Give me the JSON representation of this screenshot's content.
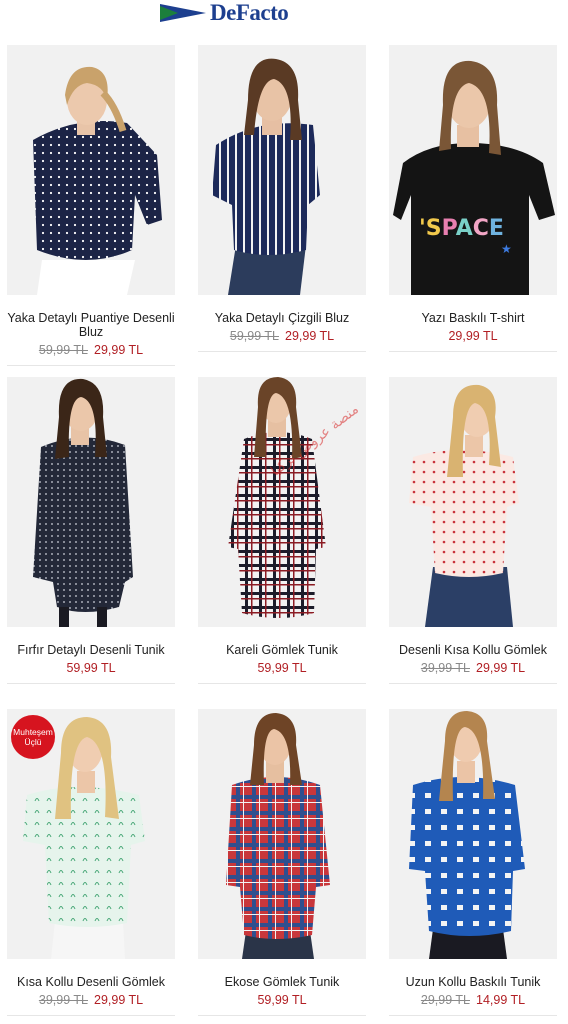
{
  "brand": {
    "name": "DeFacto",
    "accent": "#1d3f8f",
    "flag_green": "#1c7f3c"
  },
  "products": [
    {
      "name": "Yaka Detaylı Puantiye Desenli Bluz",
      "old_price": "59,99 TL",
      "price": "29,99 TL"
    },
    {
      "name": "Yaka Detaylı Çizgili Bluz",
      "old_price": "59,99 TL",
      "price": "29,99 TL"
    },
    {
      "name": "Yazı Baskılı T-shirt",
      "old_price": "",
      "price": "29,99 TL",
      "print": "SPACE"
    },
    {
      "name": "Fırfır Detaylı Desenli Tunik",
      "old_price": "",
      "price": "59,99 TL"
    },
    {
      "name": "Kareli Gömlek Tunik",
      "old_price": "",
      "price": "59,99 TL"
    },
    {
      "name": "Desenli Kısa Kollu Gömlek",
      "old_price": "39,99 TL",
      "price": "29,99 TL"
    },
    {
      "name": "Kısa Kollu Desenli Gömlek",
      "old_price": "39,99 TL",
      "price": "29,99 TL",
      "badge": "Muhteşem Üçlü"
    },
    {
      "name": "Ekose Gömlek Tunik",
      "old_price": "",
      "price": "59,99 TL"
    },
    {
      "name": "Uzun Kollu Baskılı Tunik",
      "old_price": "29,99 TL",
      "price": "14,99 TL"
    }
  ],
  "watermark": "منصة عروض تركيا",
  "colors": {
    "price_red": "#b11f24",
    "old_grey": "#8a8a8a"
  }
}
